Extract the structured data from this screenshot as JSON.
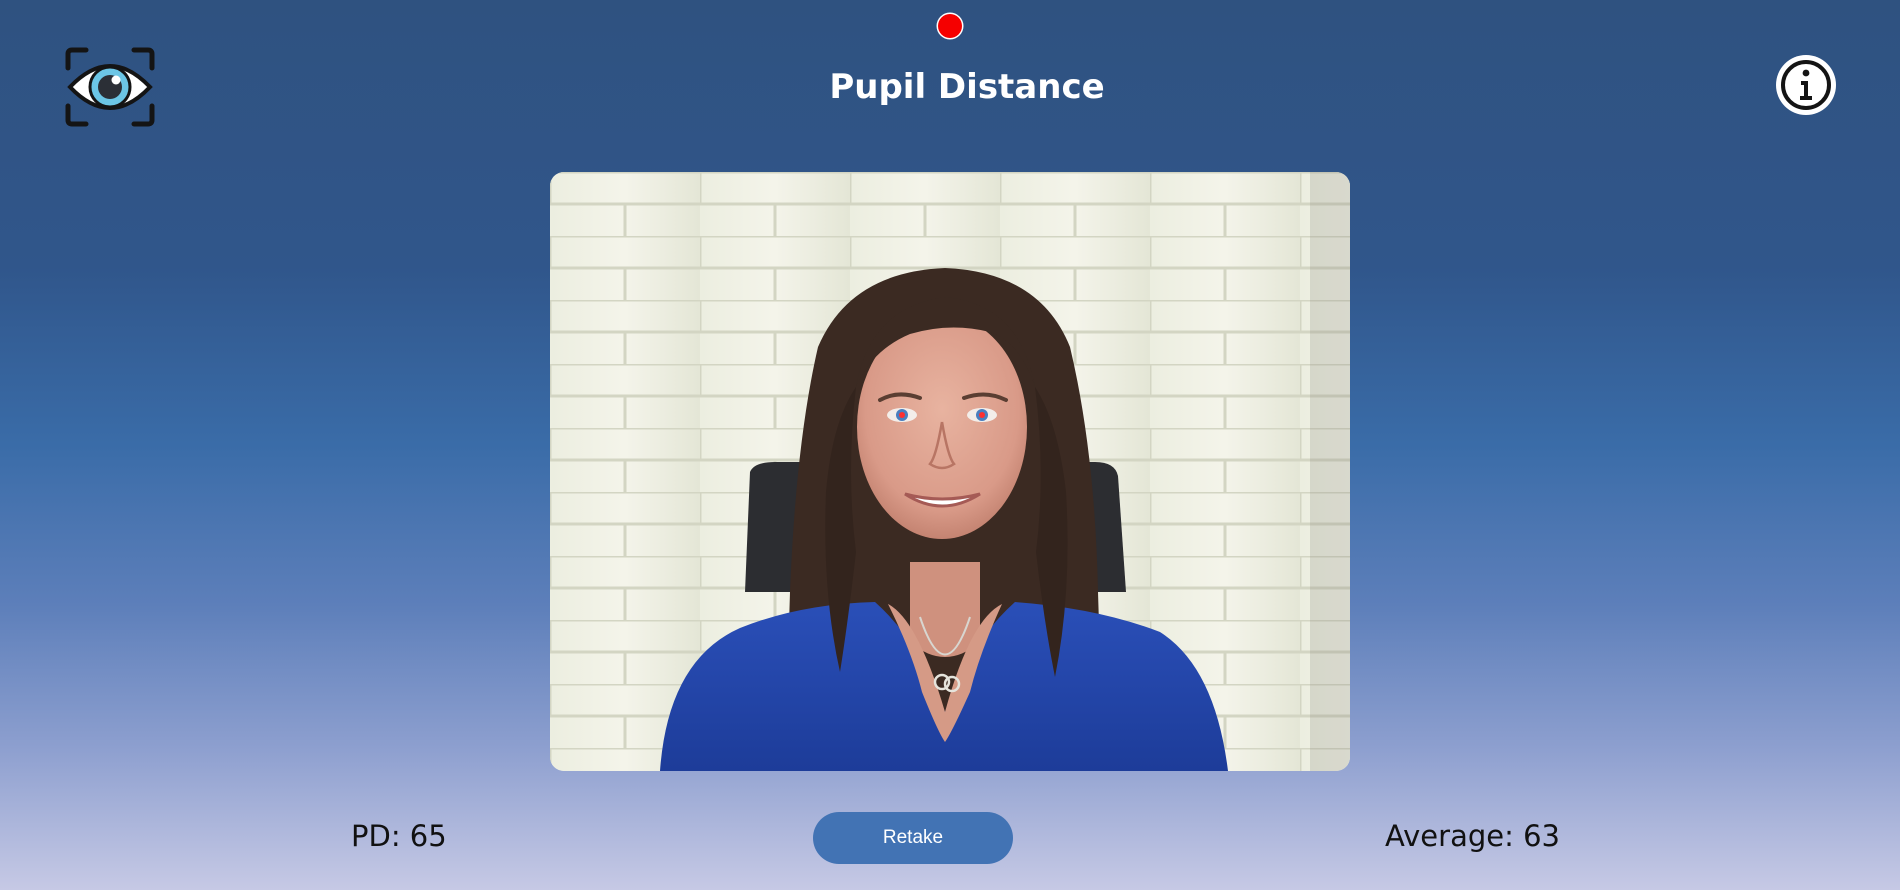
{
  "header": {
    "title": "Pupil Distance",
    "logo_icon": "eye-scan-icon",
    "info_icon": "info-icon",
    "recording_indicator_color": "#f50000"
  },
  "camera": {
    "feed": "webcam-feed",
    "pupil_marker_color": "#ff3030"
  },
  "footer": {
    "pd_text": "PD: 65",
    "retake_label": "Retake",
    "average_text": "Average: 63"
  },
  "colors": {
    "accent": "#4273b4",
    "background_top": "#2f5280",
    "background_bottom": "#c6c9e5",
    "title": "#ffffff",
    "footer_text": "#111111"
  }
}
